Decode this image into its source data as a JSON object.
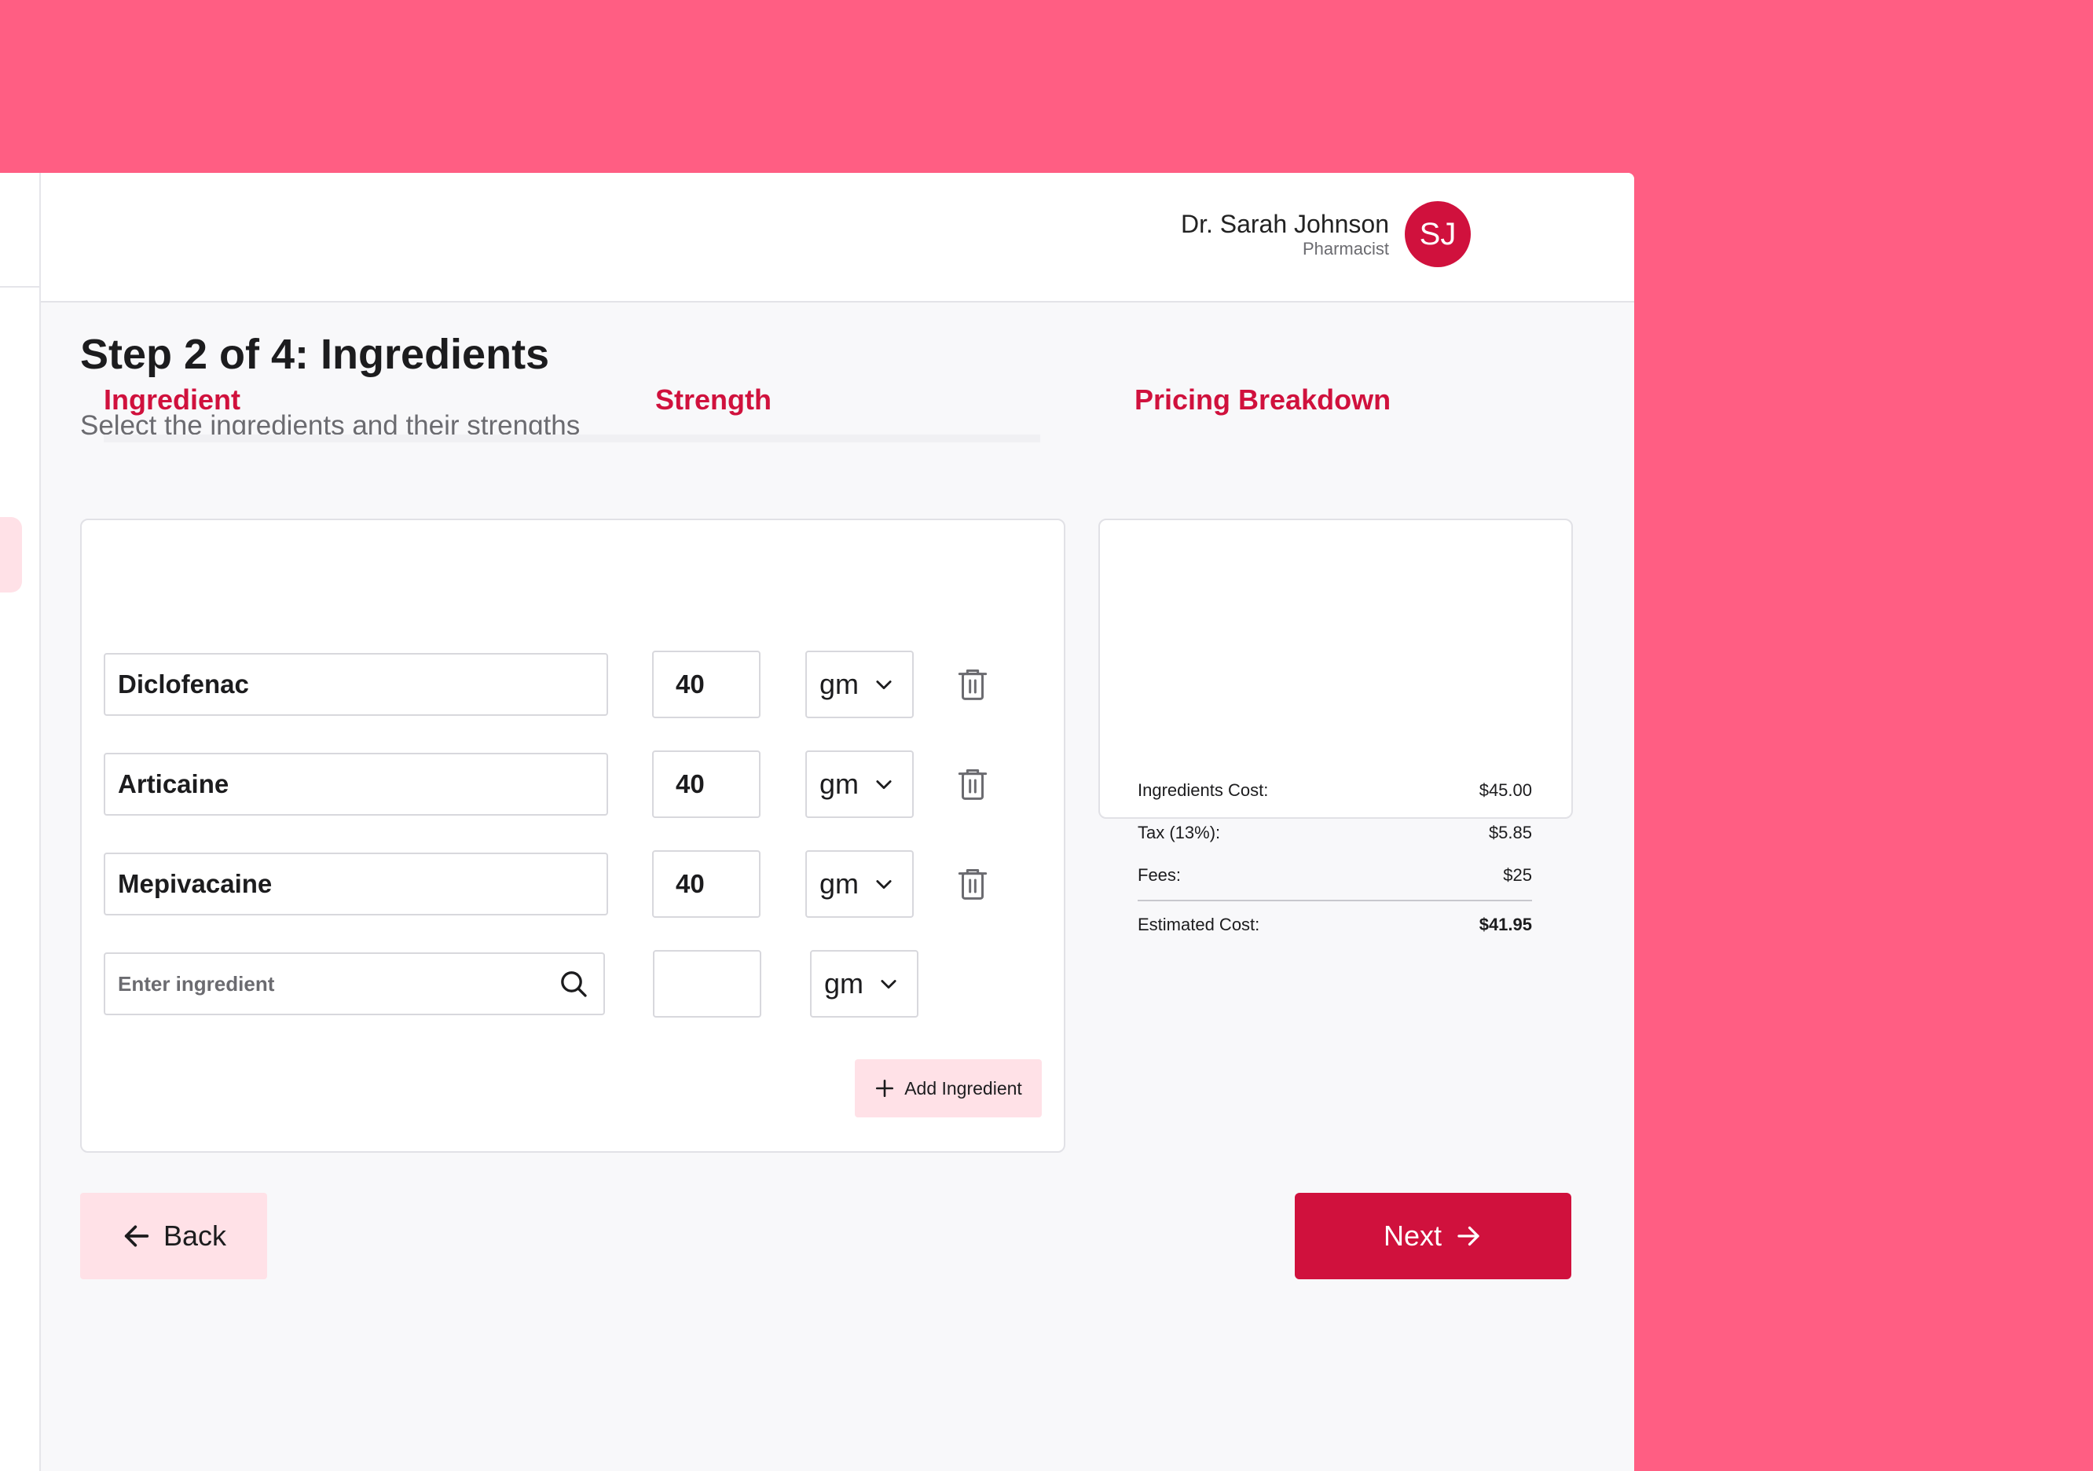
{
  "header": {
    "user_name": "Dr. Sarah Johnson",
    "user_role": "Pharmacist",
    "avatar_initials": "SJ"
  },
  "page": {
    "title": "Step 2 of 4: Ingredients",
    "subtitle": "Select the ingredients and their strengths"
  },
  "ingredients_table": {
    "col_ingredient": "Ingredient",
    "col_strength": "Strength",
    "rows": [
      {
        "name": "Diclofenac",
        "strength": "40",
        "unit": "gm"
      },
      {
        "name": "Articaine",
        "strength": "40",
        "unit": "gm"
      },
      {
        "name": "Mepivacaine",
        "strength": "40",
        "unit": "gm"
      }
    ],
    "new_row": {
      "placeholder": "Enter ingredient",
      "strength": "",
      "unit": "gm"
    },
    "add_label": "Add Ingredient"
  },
  "pricing": {
    "title": "Pricing Breakdown",
    "ingredients_cost_label": "Ingredients Cost:",
    "ingredients_cost_value": "$45.00",
    "tax_label": "Tax (13%):",
    "tax_value": "$5.85",
    "fees_label": "Fees:",
    "fees_value": "$25",
    "estimated_label": "Estimated Cost:",
    "estimated_value": "$41.95"
  },
  "nav": {
    "back_label": "Back",
    "next_label": "Next"
  },
  "colors": {
    "background": "#ff5e83",
    "accent": "#d0113d",
    "accent_soft": "#ffe1e7"
  },
  "icons": {
    "delete": "trash-icon",
    "unit_dropdown": "chevron-down-icon",
    "search": "search-icon",
    "add": "plus-icon",
    "back": "arrow-left-icon",
    "next": "arrow-right-icon"
  }
}
